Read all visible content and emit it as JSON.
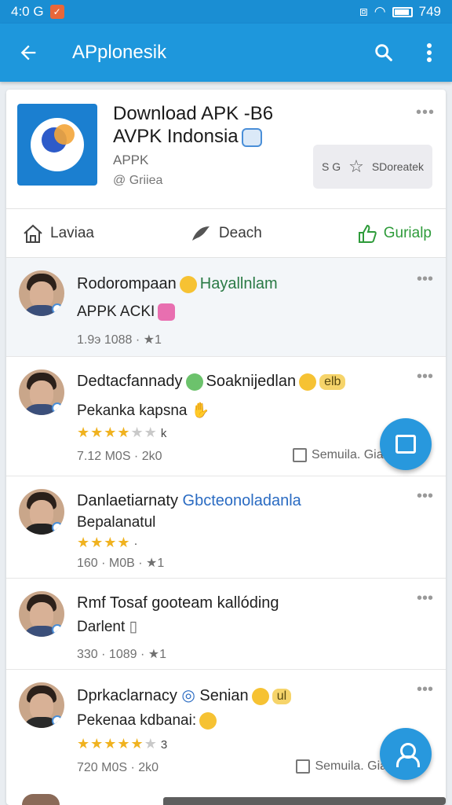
{
  "status": {
    "time": "4:0 G",
    "right": "749"
  },
  "appbar": {
    "title": "APplonesik"
  },
  "app": {
    "title_line1": "Download APK -B6",
    "title_line2": "AVPK Indonsia",
    "subtitle": "APPK",
    "developer": "@ Griiea",
    "install_label1": "S G",
    "install_label2": "SDoreatek"
  },
  "actions": [
    {
      "label": "Laviaa",
      "icon": "home-icon"
    },
    {
      "label": "Deach",
      "icon": "bird-icon"
    },
    {
      "label": "Gurialp",
      "icon": "thumb-up-icon"
    }
  ],
  "reviews": [
    {
      "name": "Rodorompaan",
      "name_hl": "Hayallnlam",
      "line2": "APPK ACKI",
      "rating": null,
      "meta": "1.9э 1088 · ★1",
      "side": ""
    },
    {
      "name": "Dedtacfannady",
      "name_hl": "Soaknijedlan",
      "tag": "elb",
      "line2": "Pekanka kapsna",
      "rating": "4",
      "rating_label": "k",
      "meta": "7.12 M0S · 2k0",
      "side": "Semuila. Giaroetad"
    },
    {
      "name": "Danlaetiarnaty",
      "name_hl": "Gbcteonoladanla",
      "line2": "Bepalanatul",
      "rating": "4",
      "rating_label": "·",
      "meta": "160 · M0B · ★1",
      "side": ""
    },
    {
      "name": "Rmf Tosaf gooteam kallóding",
      "name_hl": "",
      "line2": "Darlent",
      "rating": null,
      "meta": "330 · 1089 · ★1",
      "side": ""
    },
    {
      "name": "Dprkaclarnacy",
      "name_hl": "Senian",
      "tag": "ul",
      "line2": "Pekenaa kdbanai:",
      "rating": "5",
      "rating_label": "3",
      "meta": "720 M0S · 2k0",
      "side": "Semuila. Giartatud"
    }
  ]
}
